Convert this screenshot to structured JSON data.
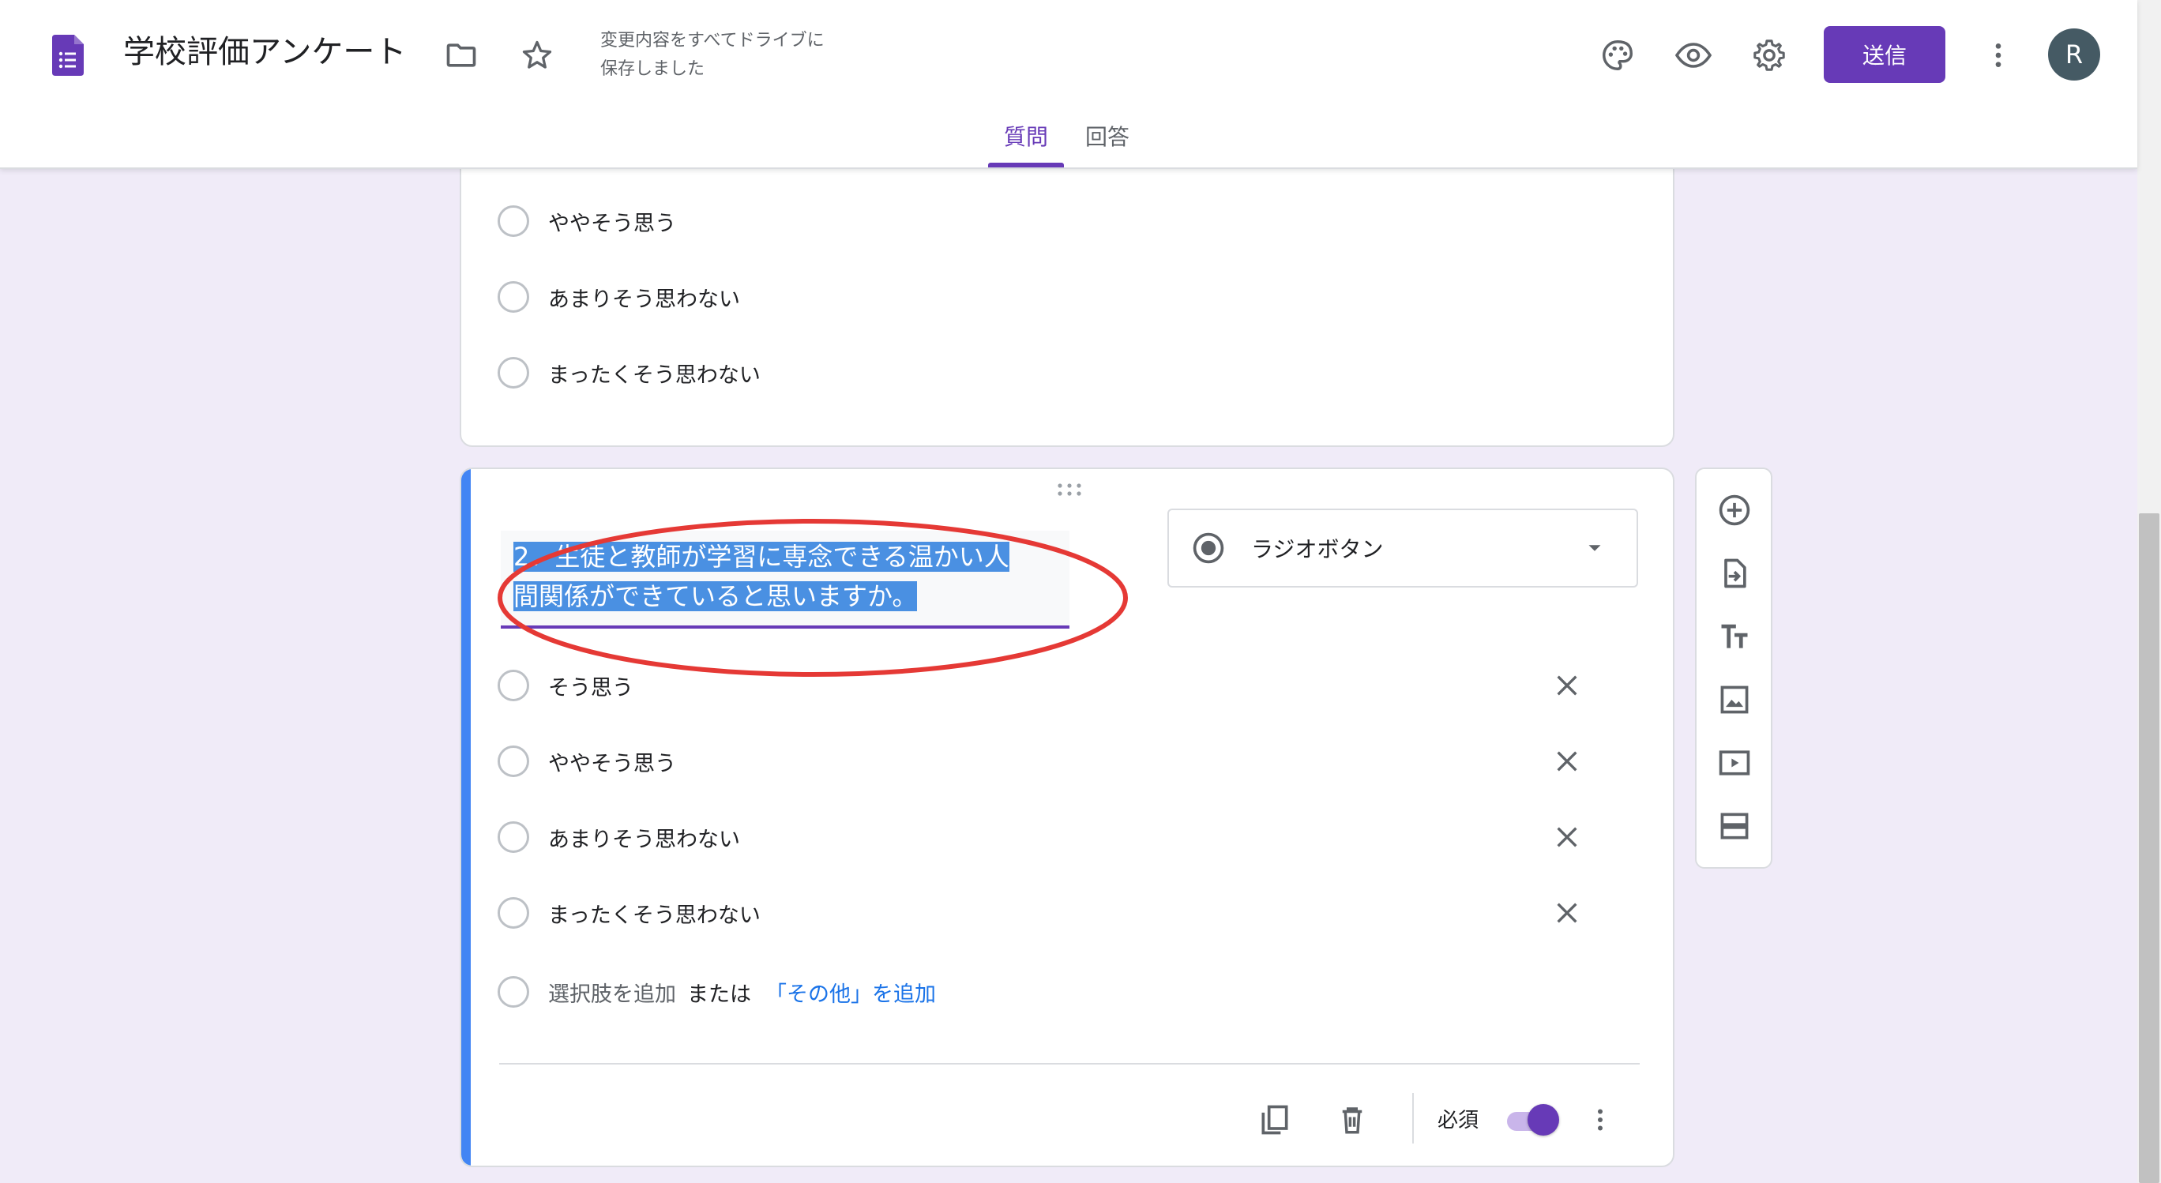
{
  "header": {
    "title": "学校評価アンケート",
    "save_status_line1": "変更内容をすべてドライブに",
    "save_status_line2": "保存しました",
    "send_label": "送信",
    "avatar_initial": "R",
    "icons": [
      "folder-icon",
      "star-icon",
      "palette-icon",
      "preview-icon",
      "settings-icon",
      "more-icon"
    ]
  },
  "tabs": [
    {
      "label": "質問",
      "active": true
    },
    {
      "label": "回答",
      "active": false
    }
  ],
  "previous_card": {
    "options": [
      "ややそう思う",
      "あまりそう思わない",
      "まったくそう思わない"
    ]
  },
  "question_card": {
    "title_line1": "2．生徒と教師が学習に専念できる温かい人",
    "title_line2": "間関係ができていると思いますか。",
    "type_label": "ラジオボタン",
    "options": [
      "そう思う",
      "ややそう思う",
      "あまりそう思わない",
      "まったくそう思わない"
    ],
    "add_option": "選択肢を追加",
    "or_text": "または",
    "add_other": "「その他」を追加",
    "required_label": "必須",
    "required_on": true,
    "annotation_color": "#e53935"
  },
  "side_toolbar": [
    "add-question-icon",
    "import-icon",
    "title-text-icon",
    "image-icon",
    "video-icon",
    "section-icon"
  ],
  "colors": {
    "accent": "#673ab7",
    "background": "#f0ebf8",
    "active_bar": "#4285f4",
    "link": "#1a73e8"
  }
}
